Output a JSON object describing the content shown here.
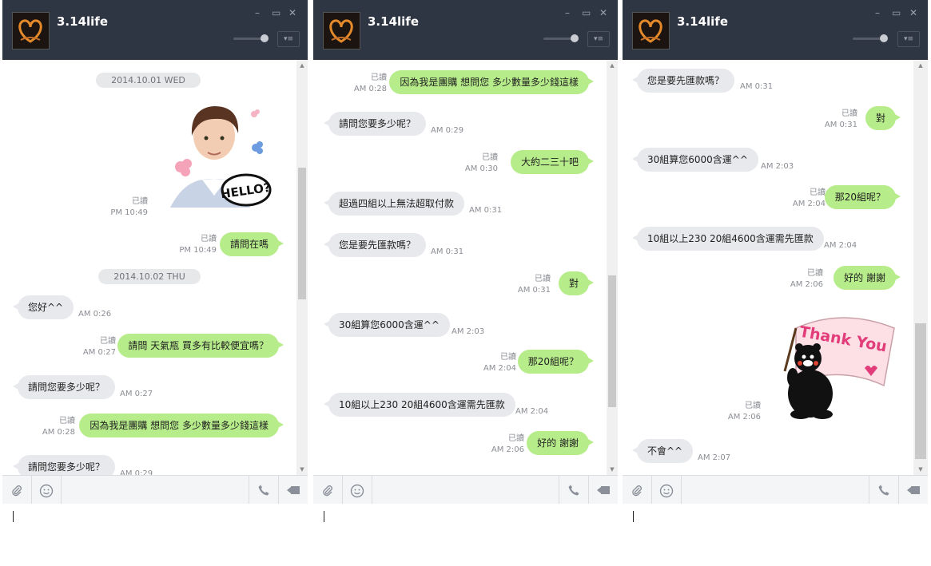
{
  "windows": [
    {
      "title": "3.14life",
      "minimize": "–",
      "maximize": "▭",
      "close": "✕",
      "messages": [
        {
          "kind": "date",
          "text": "2014.10.01 WED"
        },
        {
          "kind": "sticker",
          "name": "hello-sticker",
          "text": "HELLO?",
          "read": "已讀",
          "time": "PM 10:49"
        },
        {
          "kind": "out",
          "text": "請問在嗎",
          "read": "已讀",
          "time": "PM 10:49"
        },
        {
          "kind": "date",
          "text": "2014.10.02 THU"
        },
        {
          "kind": "in",
          "text": "您好^^",
          "time": "AM 0:26"
        },
        {
          "kind": "out",
          "text": "請問 天氣瓶 買多有比較便宜嗎？",
          "read": "已讀",
          "time": "AM 0:27"
        },
        {
          "kind": "in",
          "text": "請問您要多少呢？",
          "time": "AM 0:27"
        },
        {
          "kind": "out",
          "text": "因為我是團購 想問您 多少數量多少錢這樣",
          "read": "已讀",
          "time": "AM 0:28"
        },
        {
          "kind": "in",
          "text": "請問您要多少呢？",
          "time": "AM 0:29"
        }
      ]
    },
    {
      "title": "3.14life",
      "minimize": "–",
      "maximize": "▭",
      "close": "✕",
      "messages": [
        {
          "kind": "out",
          "text": "因為我是團購 想問您 多少數量多少錢這樣",
          "read": "已讀",
          "time": "AM 0:28"
        },
        {
          "kind": "in",
          "text": "請問您要多少呢？",
          "time": "AM 0:29"
        },
        {
          "kind": "out",
          "text": "大約二三十吧",
          "read": "已讀",
          "time": "AM 0:30"
        },
        {
          "kind": "in",
          "text": "超過四組以上無法超取付款",
          "time": "AM 0:31"
        },
        {
          "kind": "in",
          "text": "您是要先匯款嗎？",
          "time": "AM 0:31"
        },
        {
          "kind": "out",
          "text": "對",
          "read": "已讀",
          "time": "AM 0:31"
        },
        {
          "kind": "in",
          "text": "30組算您6000含運^^",
          "time": "AM 2:03"
        },
        {
          "kind": "out",
          "text": "那20組呢？",
          "read": "已讀",
          "time": "AM 2:04"
        },
        {
          "kind": "in",
          "text": "10組以上230 20組4600含運需先匯款",
          "time": "AM 2:04"
        },
        {
          "kind": "out",
          "text": "好的 謝謝",
          "read": "已讀",
          "time": "AM 2:06"
        }
      ]
    },
    {
      "title": "3.14life",
      "minimize": "–",
      "maximize": "▭",
      "close": "✕",
      "messages": [
        {
          "kind": "in",
          "text": "您是要先匯款嗎？",
          "time": "AM 0:31"
        },
        {
          "kind": "out",
          "text": "對",
          "read": "已讀",
          "time": "AM 0:31"
        },
        {
          "kind": "in",
          "text": "30組算您6000含運^^",
          "time": "AM 2:03"
        },
        {
          "kind": "out",
          "text": "那20組呢？",
          "read": "已讀",
          "time": "AM 2:04"
        },
        {
          "kind": "in",
          "text": "10組以上230 20組4600含運需先匯款",
          "time": "AM 2:04"
        },
        {
          "kind": "out",
          "text": "好的 謝謝",
          "read": "已讀",
          "time": "AM 2:06"
        },
        {
          "kind": "sticker",
          "name": "thank-you-sticker",
          "text": "Thank You",
          "read": "已讀",
          "time": "AM 2:06"
        },
        {
          "kind": "in",
          "text": "不會^^",
          "time": "AM 2:07"
        }
      ]
    }
  ],
  "toolbar_icons": [
    "paperclip-icon",
    "smiley-icon",
    "phone-icon",
    "video-icon"
  ],
  "colors": {
    "titlebar": "#2f3643",
    "outgoing_bubble": "#b7ec8a",
    "incoming_bubble": "#e8e9ec"
  }
}
